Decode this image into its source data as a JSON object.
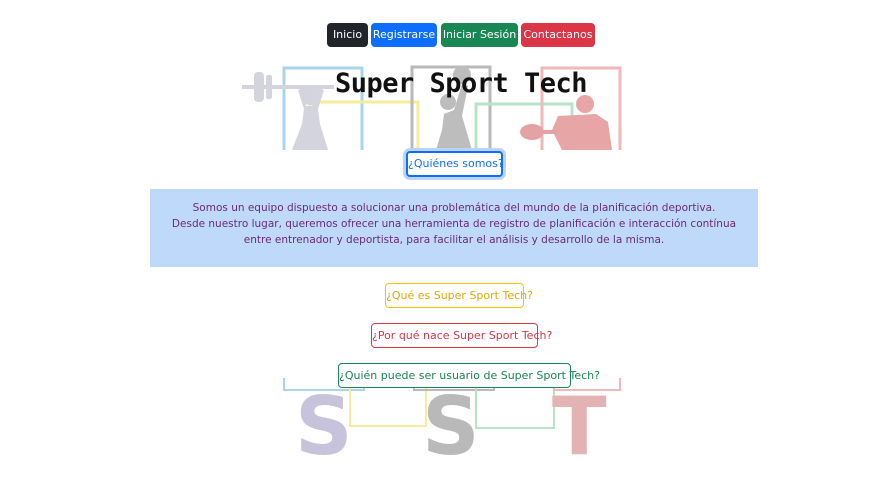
{
  "nav": {
    "items": [
      {
        "label": "Inicio",
        "color": "#212529"
      },
      {
        "label": "Registrarse",
        "color": "#0d6efd"
      },
      {
        "label": "Iniciar Sesión",
        "color": "#198754"
      },
      {
        "label": "Contactanos",
        "color": "#dc3545"
      }
    ]
  },
  "hero": {
    "title": "Super Sport Tech"
  },
  "about": {
    "button_label": "¿Quiénes somos?",
    "lines": [
      "Somos un equipo dispuesto a solucionar una problemática del mundo de la planificación deportiva.",
      "Desde nuestro lugar, queremos ofrecer una herramienta de registro de planificación e interacción contínua",
      "entre entrenador y deportista, para facilitar el análisis y desarrollo de la misma."
    ]
  },
  "questions": [
    {
      "label": "¿Qué es Super Sport Tech?",
      "color": "#ffc107"
    },
    {
      "label": "¿Por qué nace Super Sport Tech?",
      "color": "#dc3545"
    },
    {
      "label": "¿Quién puede ser usuario de Super Sport Tech?",
      "color": "#198754"
    }
  ],
  "logo": {
    "letters": [
      "S",
      "S",
      "T"
    ]
  }
}
